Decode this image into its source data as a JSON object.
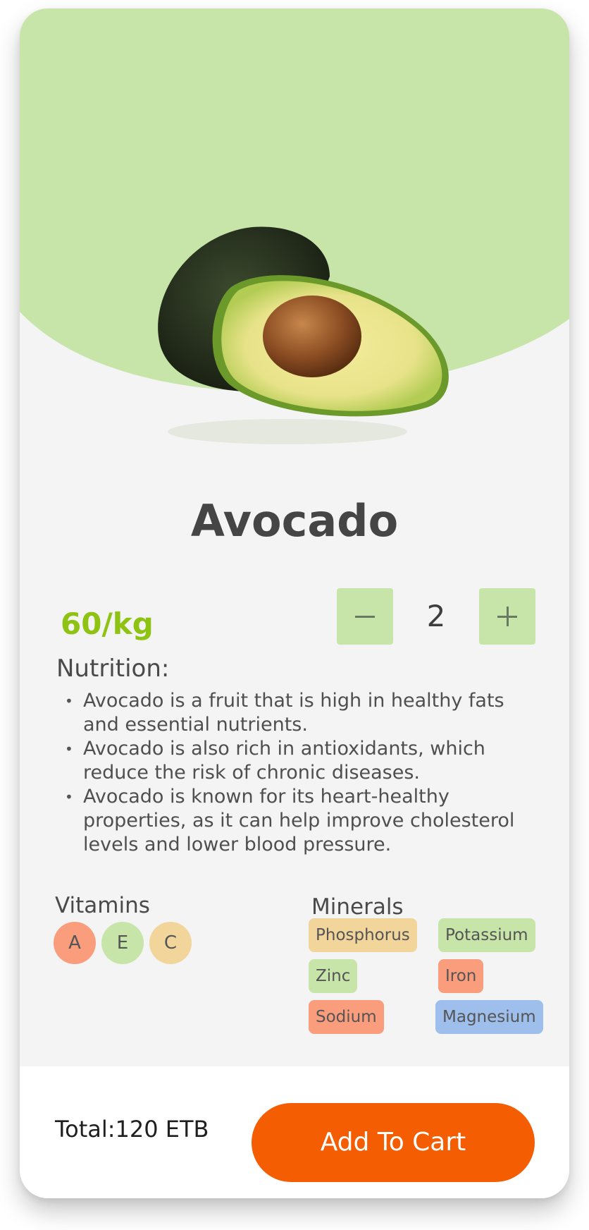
{
  "product": {
    "name": "Avocado",
    "price": "60/kg",
    "quantity": "2",
    "image": "avocado-image"
  },
  "nutrition": {
    "title": "Nutrition:",
    "items": [
      "Avocado is a fruit that is high in healthy fats and essential nutrients.",
      "Avocado is also rich in antioxidants, which reduce the risk of chronic diseases.",
      "Avocado is known for its heart-healthy properties, as it can help improve cholesterol levels and lower blood pressure."
    ]
  },
  "vitamins": {
    "title": "Vitamins",
    "items": [
      "A",
      "E",
      "C"
    ]
  },
  "minerals": {
    "title": "Minerals",
    "items": [
      "Phosphorus",
      "Potassium",
      "Zinc",
      "Iron",
      "Sodium",
      "Magnesium"
    ]
  },
  "footer": {
    "total": "Total:120 ETB",
    "cart_label": "Add To Cart"
  },
  "icons": {
    "minus": "minus-icon",
    "plus": "plus-icon"
  },
  "colors": {
    "hero_green": "#c7e5a8",
    "price_green": "#8ec313",
    "cta_orange": "#f45d02",
    "chip_orange": "#f99d7d",
    "chip_yellow": "#f2d59a",
    "chip_blue": "#9ebfeb"
  }
}
